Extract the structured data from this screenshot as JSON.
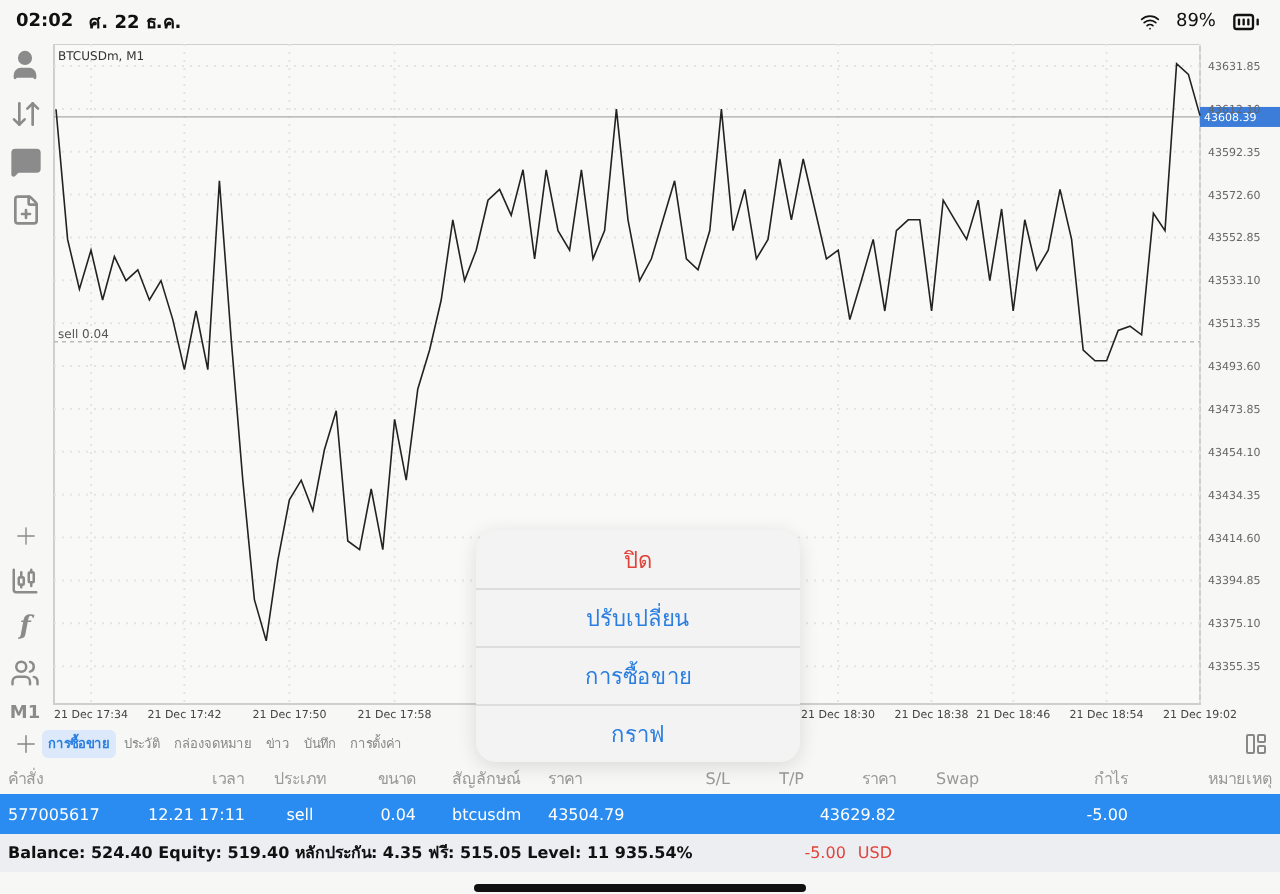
{
  "status_bar": {
    "time": "02:02",
    "date": "ศ. 22 ธ.ค.",
    "battery": "89%"
  },
  "toolbar": {
    "indicator_glyph": "f",
    "timeframe": "M1"
  },
  "chart": {
    "chart_data": {
      "type": "line",
      "title": "BTCUSDm, M1",
      "categories": [
        null,
        null,
        null,
        "21 Dec 17:34",
        null,
        null,
        null,
        null,
        null,
        null,
        null,
        "21 Dec 17:42",
        null,
        null,
        null,
        null,
        null,
        null,
        null,
        null,
        "21 Dec 17:50",
        null,
        null,
        null,
        null,
        null,
        null,
        null,
        null,
        "21 Dec 17:58",
        null,
        null,
        null,
        null,
        null,
        null,
        null,
        null,
        null,
        null,
        null,
        null,
        null,
        null,
        null,
        null,
        null,
        null,
        null,
        null,
        null,
        null,
        null,
        null,
        null,
        null,
        null,
        null,
        null,
        null,
        null,
        null,
        null,
        null,
        null,
        null,
        null,
        "21 Dec 18:30",
        null,
        null,
        null,
        null,
        null,
        null,
        null,
        "21 Dec 18:38",
        null,
        null,
        null,
        null,
        null,
        null,
        "21 Dec 18:46",
        null,
        null,
        null,
        null,
        null,
        null,
        null,
        "21 Dec 18:54",
        null,
        null,
        null,
        null,
        null,
        null,
        null,
        "21 Dec 19:02"
      ],
      "series": [
        {
          "color": "#222222",
          "values": [
            43612,
            43552,
            43529,
            43547,
            43524,
            43544,
            43533,
            43538,
            43524,
            43533,
            43515,
            43492,
            43519,
            43492,
            43579,
            43506,
            43441,
            43386,
            43367,
            43404,
            43432,
            43441,
            43427,
            43455,
            43473,
            43413,
            43409,
            43437,
            43409,
            43469,
            43441,
            43483,
            43501,
            43524,
            43561,
            43533,
            43547,
            43570,
            43575,
            43563,
            43584,
            43543,
            43584,
            43556,
            43547,
            43584,
            43543,
            43556,
            43612,
            43561,
            43533,
            43543,
            43561,
            43579,
            43543,
            43538,
            43556,
            43612,
            43556,
            43575,
            43543,
            43552,
            43589,
            43561,
            43589,
            43566,
            43543,
            43547,
            43515,
            43533,
            43552,
            43519,
            43556,
            43561,
            43561,
            43519,
            43570,
            43561,
            43552,
            43570,
            43533,
            43566,
            43519,
            43561,
            43538,
            43547,
            43575,
            43552,
            43501,
            43496,
            43496,
            43510,
            43512,
            43508,
            43564,
            43556,
            43633,
            43628,
            43609
          ]
        }
      ],
      "ylim": [
        43337.9,
        43642.0
      ],
      "yticks": [
        {
          "value": 43631.85,
          "label": "43631.85"
        },
        {
          "value": 43612.1,
          "label": "43612.10"
        },
        {
          "value": 43592.35,
          "label": "43592.35"
        },
        {
          "value": 43572.6,
          "label": "43572.60"
        },
        {
          "value": 43552.85,
          "label": "43552.85"
        },
        {
          "value": 43533.1,
          "label": "43533.10"
        },
        {
          "value": 43513.35,
          "label": "43513.35"
        },
        {
          "value": 43493.6,
          "label": "43493.60"
        },
        {
          "value": 43473.85,
          "label": "43473.85"
        },
        {
          "value": 43454.1,
          "label": "43454.10"
        },
        {
          "value": 43434.35,
          "label": "43434.35"
        },
        {
          "value": 43414.6,
          "label": "43414.60"
        },
        {
          "value": 43394.85,
          "label": "43394.85"
        },
        {
          "value": 43375.1,
          "label": "43375.10"
        },
        {
          "value": 43355.35,
          "label": "43355.35"
        }
      ],
      "grid": true,
      "ref_lines": [
        {
          "axis": "y",
          "value": 43608.39,
          "label": "43608.39",
          "color": "#aaaaaa"
        },
        {
          "axis": "y",
          "value": 43504.79,
          "label": "sell 0.04",
          "color": "#bbbbbb"
        }
      ]
    }
  },
  "tabs": [
    {
      "label": "การซื้อขาย",
      "selected": true
    },
    {
      "label": "ประวัติ",
      "selected": false
    },
    {
      "label": "กล่องจดหมาย",
      "selected": false
    },
    {
      "label": "ข่าว",
      "selected": false
    },
    {
      "label": "บันทึก",
      "selected": false
    },
    {
      "label": "การตั้งค่า",
      "selected": false
    }
  ],
  "table": {
    "columns": [
      "คำสั่ง",
      "เวลา",
      "ประเภท",
      "ขนาด",
      "สัญลักษณ์",
      "ราคา",
      "S/L",
      "T/P",
      "ราคา",
      "Swap",
      "กำไร",
      "หมายเหตุ"
    ],
    "rows": [
      {
        "selected": true,
        "cells": [
          "577005617",
          "12.21 17:11",
          "sell",
          "0.04",
          "btcusdm",
          "43504.79",
          "",
          "",
          "43629.82",
          "",
          "-5.00",
          ""
        ]
      }
    ]
  },
  "summary": {
    "text": "Balance: 524.40 Equity: 519.40 หลักประกัน: 4.35 ฟรี: 515.05 Level: 11 935.54%",
    "profit": "-5.00",
    "currency": "USD"
  },
  "menu": {
    "items": [
      {
        "label": "ปิด",
        "kind": "destructive"
      },
      {
        "label": "ปรับเปลี่ยน",
        "kind": "action"
      },
      {
        "label": "การซื้อขาย",
        "kind": "action"
      },
      {
        "label": "กราฟ",
        "kind": "action"
      }
    ]
  }
}
